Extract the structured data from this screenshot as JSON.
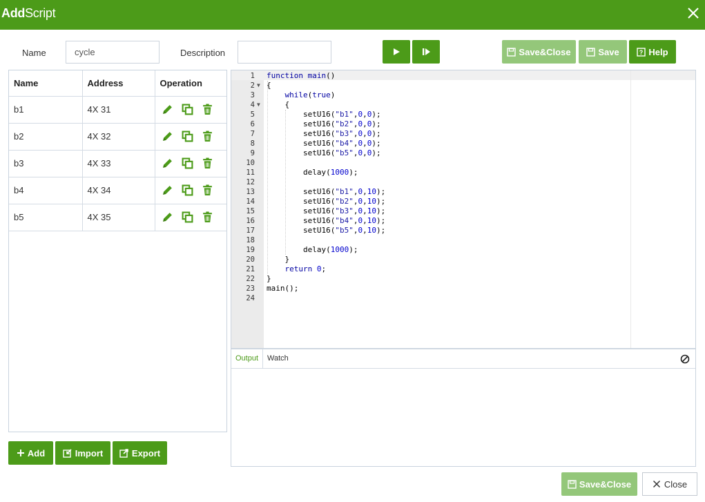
{
  "dialog": {
    "title_bold": "Add",
    "title_rest": "Script",
    "close_icon": "close-icon"
  },
  "form": {
    "name_label": "Name",
    "name_value": "cycle",
    "description_label": "Description",
    "description_value": ""
  },
  "toolbar": {
    "run_icon": "play-icon",
    "step_icon": "step-play-icon",
    "save_close_label": "Save&Close",
    "save_label": "Save",
    "help_label": "Help"
  },
  "variables": {
    "columns": [
      "Name",
      "Address",
      "Operation"
    ],
    "rows": [
      {
        "name": "b1",
        "address": "4X 31"
      },
      {
        "name": "b2",
        "address": "4X 32"
      },
      {
        "name": "b3",
        "address": "4X 33"
      },
      {
        "name": "b4",
        "address": "4X 34"
      },
      {
        "name": "b5",
        "address": "4X 35"
      }
    ],
    "operation_icons": [
      "edit-icon",
      "copy-icon",
      "delete-icon"
    ]
  },
  "var_buttons": {
    "add_label": "Add",
    "import_label": "Import",
    "export_label": "Export"
  },
  "editor": {
    "lines": [
      "function main()",
      "{",
      "    while(true)",
      "    {",
      "        setU16(\"b1\",0,0);",
      "        setU16(\"b2\",0,0);",
      "        setU16(\"b3\",0,0);",
      "        setU16(\"b4\",0,0);",
      "        setU16(\"b5\",0,0);",
      "",
      "        delay(1000);",
      "",
      "        setU16(\"b1\",0,10);",
      "        setU16(\"b2\",0,10);",
      "        setU16(\"b3\",0,10);",
      "        setU16(\"b4\",0,10);",
      "        setU16(\"b5\",0,10);",
      "",
      "        delay(1000);",
      "    }",
      "    return 0;",
      "}",
      "main();",
      ""
    ],
    "fold_lines": [
      2,
      4
    ]
  },
  "output": {
    "tabs": [
      "Output",
      "Watch"
    ],
    "active_tab": "Output",
    "clear_icon": "clear-icon"
  },
  "footer": {
    "save_close_label": "Save&Close",
    "close_label": "Close"
  },
  "colors": {
    "primary": "#4c9b19",
    "primary_disabled": "#94c77a"
  }
}
